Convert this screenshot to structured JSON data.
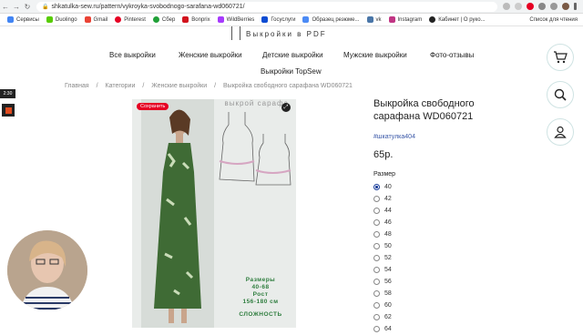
{
  "browser": {
    "url": "shkatulka-sew.ru/pattern/vykroyka-svobodnogo-sarafana-wd060721/",
    "bookmarks": [
      "Сервисы",
      "Duolingo",
      "Gmail",
      "Pinterest",
      "Сбер",
      "Bonprix",
      "WildBerries",
      "Госуслуги",
      "Образец резюме...",
      "vk",
      "Instagram",
      "Кабинет | О руко..."
    ],
    "reading_list": "Список для чтения"
  },
  "site": {
    "brand": "Выкройки в PDF",
    "menu": [
      "Все выкройки",
      "Женские выкройки",
      "Детские выкройки",
      "Мужские выкройки",
      "Фото-отзывы",
      "Выкройки TopSew"
    ],
    "breadcrumbs": [
      "Главная",
      "/",
      "Категории",
      "/",
      "Женские выкройки",
      "/",
      "Выкройка свободного сарафана WD060721"
    ]
  },
  "product": {
    "save_label": "Сохранить",
    "image_title": "выкрой сарафа",
    "image_sizes": [
      "Размеры",
      "40-68",
      "Рост",
      "156-180 см",
      "СЛОЖНОСТЬ"
    ],
    "title": "Выкройка свободного сарафана WD060721",
    "tag": "#шкатулка404",
    "price": "65р.",
    "size_label": "Размер",
    "sizes": [
      "40",
      "42",
      "44",
      "46",
      "48",
      "50",
      "52",
      "54",
      "56",
      "58",
      "60",
      "62",
      "64"
    ],
    "selected_size": "40"
  },
  "overlay": {
    "timer": "2:30"
  }
}
